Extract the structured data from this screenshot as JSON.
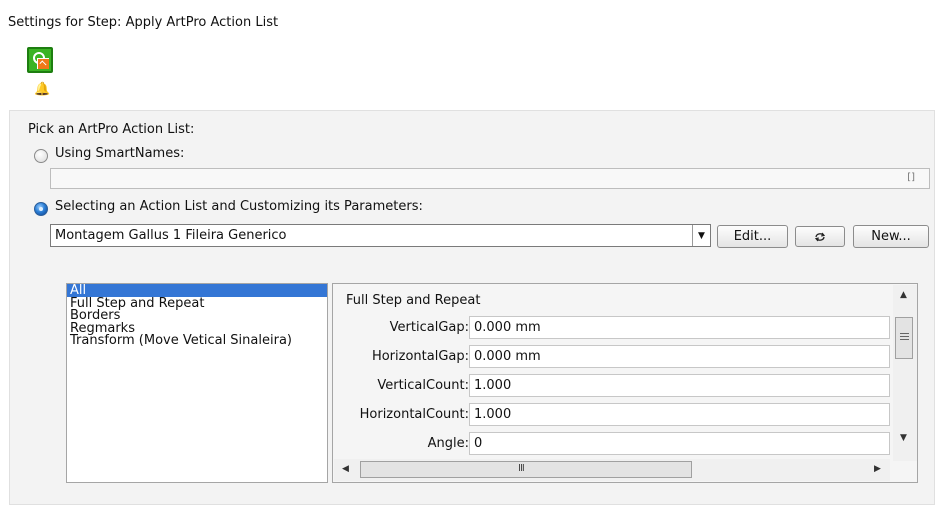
{
  "window": {
    "title": "Settings for Step: Apply ArtPro Action List"
  },
  "icons": {
    "step": "step-plugin-icon",
    "notification": "bell-icon"
  },
  "pick": {
    "label": "Pick an ArtPro Action List:",
    "smartnames_label": "Using SmartNames:",
    "smartnames_value": "",
    "smartnames_expand": "[]",
    "selecting_label": "Selecting an Action List and Customizing its Parameters:",
    "selected_option": "smartnames=false, selecting=true"
  },
  "action_list": {
    "value": "Montagem Gallus 1 Fileira Generico",
    "edit_label": "Edit...",
    "refresh_icon": "refresh-icon",
    "new_label": "New..."
  },
  "categories": {
    "items": [
      "All",
      "Full Step and Repeat",
      "Borders",
      "Regmarks",
      "Transform (Move Vetical Sinaleira)"
    ],
    "selected": "All"
  },
  "parameters": {
    "section": "Full Step and Repeat",
    "rows": [
      {
        "label": "VerticalGap:",
        "value": "0.000 mm"
      },
      {
        "label": "HorizontalGap:",
        "value": "0.000 mm"
      },
      {
        "label": "VerticalCount:",
        "value": "1.000"
      },
      {
        "label": "HorizontalCount:",
        "value": "1.000"
      },
      {
        "label": "Angle:",
        "value": "0"
      }
    ]
  },
  "colors": {
    "step_icon": "#3bb324",
    "selection": "#3476d5"
  }
}
